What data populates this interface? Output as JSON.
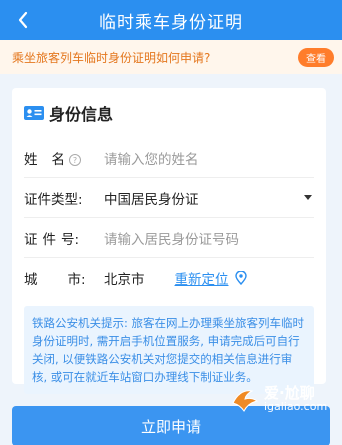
{
  "header": {
    "title": "临时乘车身份证明",
    "back_icon": "chevron-left-icon"
  },
  "notice": {
    "text": "乘坐旅客列车临时身份证明如何申请?",
    "button_label": "查看"
  },
  "card": {
    "title": "身份信息",
    "icon": "id-card-icon",
    "name_label_1": "姓",
    "name_label_2": "名",
    "name_placeholder": "请输入您的姓名",
    "id_type_label": "证件类型:",
    "id_type_value": "中国居民身份证",
    "id_number_label_1": "证",
    "id_number_label_2": "件",
    "id_number_label_3": "号:",
    "id_number_placeholder": "请输入居民身份证号码",
    "city_label_1": "城",
    "city_label_2": "市:",
    "city_value": "北京市",
    "relocate_label": "重新定位",
    "tip": "铁路公安机关提示: 旅客在网上办理乘坐旅客列车临时身份证明时, 需开启手机位置服务, 申请完成后可自行关闭, 以便铁路公安机关对您提交的相关信息进行审核, 或可在就近车站窗口办理线下制证业务。"
  },
  "submit": {
    "label": "立即申请"
  },
  "watermark": {
    "line1": "爱·尬聊",
    "line2": "igaliao.com"
  },
  "colors": {
    "primary": "#2b8ff0",
    "notice": "#e4771e",
    "notice_button": "#ff7d2b"
  }
}
